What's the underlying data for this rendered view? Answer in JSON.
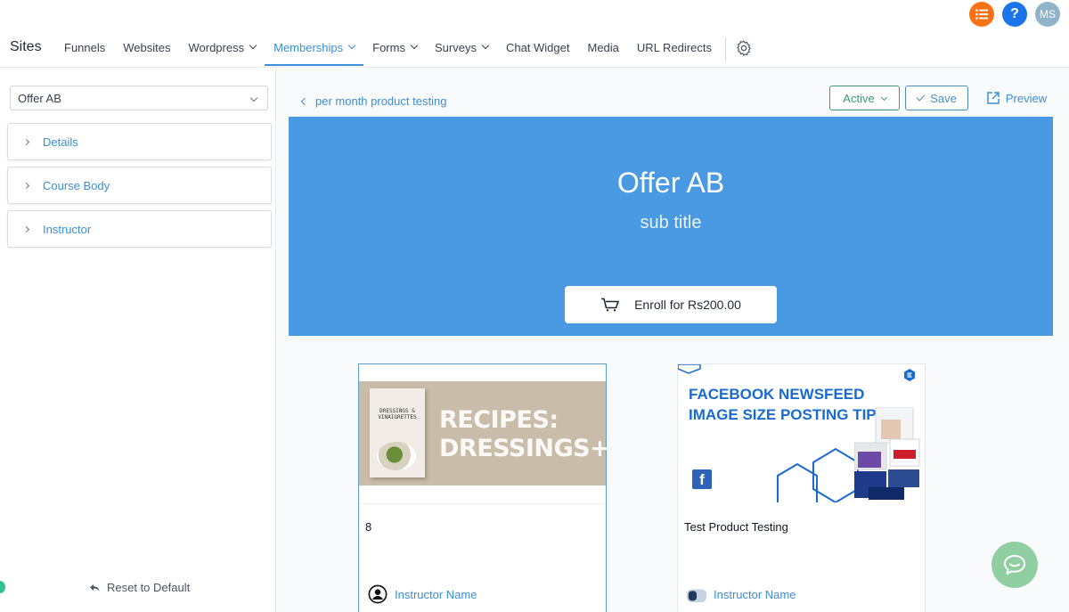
{
  "header": {
    "brand": "Sites",
    "nav": [
      {
        "label": "Funnels"
      },
      {
        "label": "Websites"
      },
      {
        "label": "Wordpress"
      },
      {
        "label": "Memberships"
      },
      {
        "label": "Forms"
      },
      {
        "label": "Surveys"
      },
      {
        "label": "Chat Widget"
      },
      {
        "label": "Media"
      },
      {
        "label": "URL Redirects"
      }
    ],
    "help_label": "?",
    "avatar_initials": "MS"
  },
  "sidebar": {
    "selected_offer": "Offer AB",
    "sections": [
      {
        "label": "Details"
      },
      {
        "label": "Course Body"
      },
      {
        "label": "Instructor"
      }
    ],
    "reset_label": "Reset to Default"
  },
  "main": {
    "back_label": "per month product testing",
    "status_label": "Active",
    "save_label": "Save",
    "preview_label": "Preview",
    "hero": {
      "title": "Offer AB",
      "subtitle": "sub title",
      "enroll_label": "Enroll for Rs200.00"
    },
    "products": [
      {
        "title": "8",
        "instructor": "Instructor Name",
        "image_text": "RECIPES: DRESSINGS+",
        "book_title": "DRESSINGS & VINAIGRETTES"
      },
      {
        "title": "Test Product Testing",
        "instructor": "Instructor Name",
        "image_text": "FACEBOOK NEWSFEED IMAGE SIZE POSTING TIPS"
      }
    ]
  },
  "colors": {
    "accent": "#3b8ed8",
    "hero_bg": "#4a9ae3",
    "active_green": "#3e9b6f",
    "chat_bubble": "#8fcfa1"
  }
}
